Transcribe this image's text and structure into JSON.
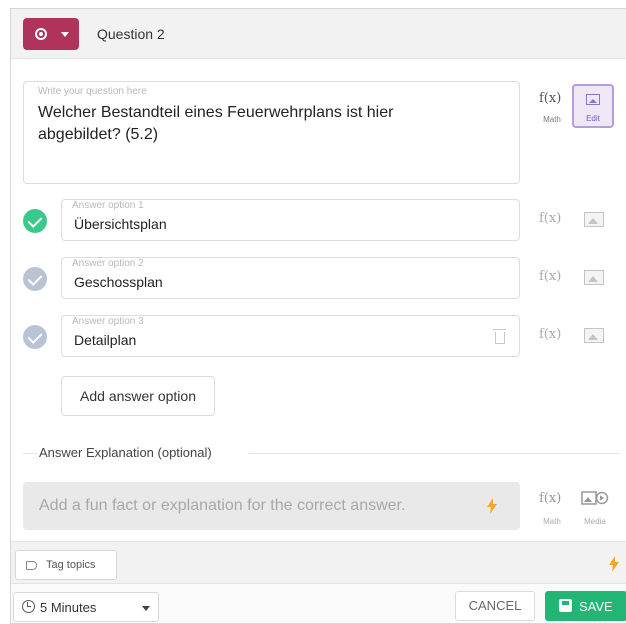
{
  "header": {
    "question_title": "Question 2",
    "type_icon": "radio-icon",
    "type_color": "#b0335c"
  },
  "question": {
    "placeholder": "Write your question here",
    "text": "Welcher Bestandteil eines Feuerwehrplans ist hier abgebildet? (5.2)",
    "math_symbol": "f(x)",
    "math_label": "Math",
    "edit_label": "Edit"
  },
  "answers": [
    {
      "label": "Answer option 1",
      "text": "Übersichtsplan",
      "correct": true
    },
    {
      "label": "Answer option 2",
      "text": "Geschossplan",
      "correct": false
    },
    {
      "label": "Answer option 3",
      "text": "Detailplan",
      "correct": false
    }
  ],
  "answer_tools": {
    "math_symbol": "f(x)"
  },
  "add_answer_label": "Add answer option",
  "explanation": {
    "section_label": "Answer Explanation (optional)",
    "placeholder": "Add a fun fact or explanation for the correct answer.",
    "math_symbol": "f(x)",
    "math_label": "Math",
    "media_label": "Media"
  },
  "footer": {
    "tag_topics_label": "Tag topics",
    "time_value": "5 Minutes",
    "cancel_label": "CANCEL",
    "save_label": "SAVE"
  },
  "colors": {
    "correct": "#3bc98b",
    "incorrect": "#b9c3d6",
    "save": "#22b573",
    "bolt": "#f5a623",
    "edit_accent": "#b39ddb"
  }
}
